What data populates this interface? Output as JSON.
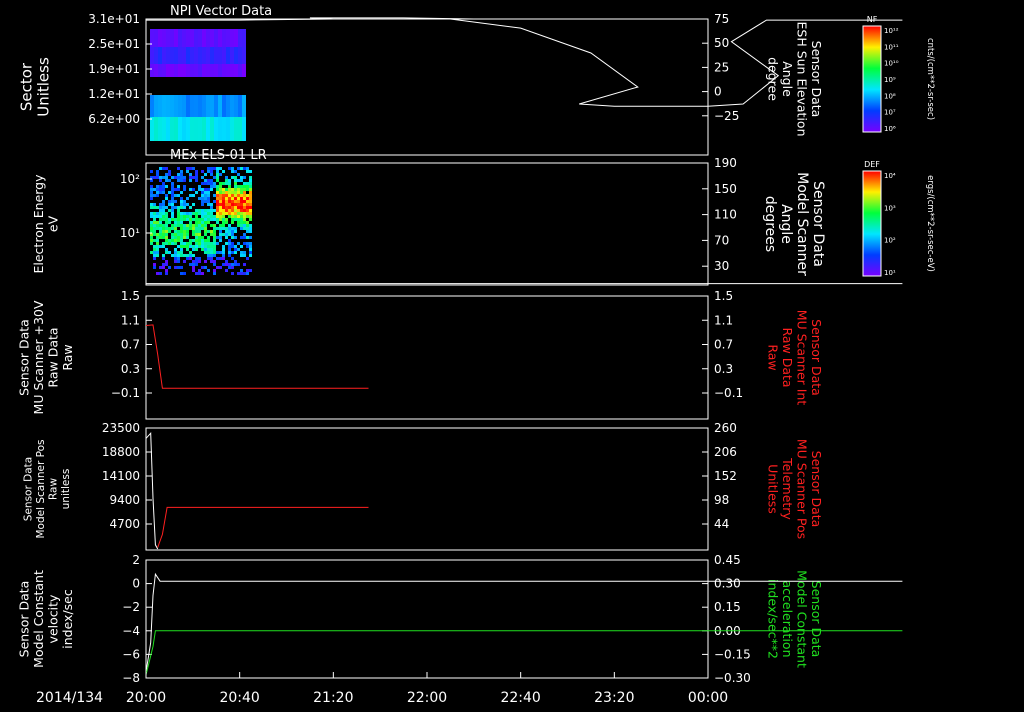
{
  "chart_data": [
    {
      "type": "heatmap",
      "title": "NPI Vector Data",
      "ylabel_left": [
        "Sector",
        "Unitless"
      ],
      "yticks_left": [
        "3.1e+01",
        "2.5e+01",
        "1.9e+01",
        "1.2e+01",
        "6.2e+00"
      ],
      "ylabel_right": [
        "Sensor Data",
        "ESH Sun Elevation",
        "Angle",
        "degree"
      ],
      "yticks_right": [
        "75",
        "50",
        "25",
        "0",
        "−25"
      ],
      "right_range": [
        -45,
        75
      ],
      "overlay_color": "#ffffff",
      "overlay_line": [
        [
          20.0,
          74
        ],
        [
          20.4,
          74
        ],
        [
          20.8,
          75
        ],
        [
          21.1,
          76
        ],
        [
          21.5,
          76
        ],
        [
          21.8,
          75
        ],
        [
          22.1,
          75
        ],
        [
          22.4,
          67
        ],
        [
          22.7,
          45
        ],
        [
          22.9,
          15
        ],
        [
          23.05,
          0
        ],
        [
          23.2,
          -2
        ],
        [
          23.6,
          -2
        ],
        [
          23.75,
          0
        ],
        [
          23.9,
          25
        ],
        [
          24.1,
          55
        ],
        [
          24.25,
          74
        ],
        [
          24.6,
          74
        ],
        [
          24.83,
          74
        ]
      ],
      "colorbar": {
        "label": "NF",
        "unit": "cnts/(cm**2-sr-sec)",
        "ticks": [
          "10¹²",
          "10¹¹",
          "10¹⁰",
          "10⁹",
          "10⁸",
          "10⁷",
          "10⁶"
        ]
      }
    },
    {
      "type": "heatmap",
      "title": "MEx ELS-01 LR",
      "ylabel_left": [
        "Electron Energy",
        "eV"
      ],
      "yticks_left": [
        "10²",
        "10¹"
      ],
      "ylabel_right": [
        "Sensor Data",
        "Model Scanner",
        "Angle",
        "degrees"
      ],
      "yticks_right": [
        "190",
        "150",
        "110",
        "70",
        "30"
      ],
      "right_range": [
        10,
        190
      ],
      "overlay_color": "#ffffff",
      "overlay_line": [
        [
          20.0,
          12
        ],
        [
          24.83,
          12
        ]
      ],
      "colorbar": {
        "label": "DEF",
        "unit": "ergs/(cm**2-sr-sec-eV)",
        "ticks": [
          "10⁴",
          "10³",
          "10²",
          "10¹"
        ]
      }
    },
    {
      "type": "line",
      "ylabel_left": [
        "Sensor Data",
        "MU Scanner +30V",
        "Raw Data",
        "Raw"
      ],
      "yticks_left": [
        "1.5",
        "1.1",
        "0.7",
        "0.3",
        "−0.1"
      ],
      "left_range": [
        -0.5,
        1.5
      ],
      "ylabel_right": [
        "Sensor Data",
        "MU Scanner Int",
        "Raw Data",
        "Raw"
      ],
      "yticks_right": [
        "1.5",
        "1.1",
        "0.7",
        "0.3",
        "−0.1"
      ],
      "series": [
        {
          "color": "#ff2020",
          "axis": "left",
          "points": [
            [
              20.0,
              1.02
            ],
            [
              20.03,
              1.03
            ],
            [
              20.05,
              0.55
            ],
            [
              20.07,
              0.0
            ],
            [
              20.1,
              0.0
            ],
            [
              20.95,
              0.0
            ]
          ]
        }
      ]
    },
    {
      "type": "line",
      "ylabel_left": [
        "Sensor Data",
        "Model Scanner Pos",
        "Raw",
        "unitless"
      ],
      "yticks_left": [
        "23500",
        "18800",
        "14100",
        "9400",
        "4700"
      ],
      "left_range": [
        0,
        23500
      ],
      "ylabel_right": [
        "Sensor Data",
        "MU Scanner Pos",
        "Telemetry",
        "Unitless"
      ],
      "yticks_right": [
        "260",
        "206",
        "152",
        "98",
        "44"
      ],
      "series": [
        {
          "color": "#ffffff",
          "axis": "left",
          "points": [
            [
              20.0,
              21500
            ],
            [
              20.02,
              22500
            ],
            [
              20.03,
              10000
            ],
            [
              20.04,
              1000
            ],
            [
              20.05,
              200
            ]
          ]
        },
        {
          "color": "#ff2020",
          "axis": "left",
          "points": [
            [
              20.05,
              500
            ],
            [
              20.07,
              3000
            ],
            [
              20.09,
              8200
            ],
            [
              20.95,
              8200
            ]
          ]
        }
      ]
    },
    {
      "type": "line",
      "ylabel_left": [
        "Sensor Data",
        "Model Constant",
        "velocity",
        "index/sec"
      ],
      "yticks_left": [
        "2",
        "0",
        "−2",
        "−4",
        "−6",
        "−8"
      ],
      "left_range": [
        -8,
        2
      ],
      "ylabel_right": [
        "Sensor Data",
        "Model Constant",
        "acceleration",
        "index/sec**2"
      ],
      "yticks_right": [
        "0.45",
        "0.30",
        "0.15",
        "0.00",
        "−0.15",
        "−0.30"
      ],
      "right_range": [
        -0.3,
        0.45
      ],
      "series": [
        {
          "color": "#ffffff",
          "axis": "left",
          "points": [
            [
              20.0,
              -7.5
            ],
            [
              20.02,
              -5
            ],
            [
              20.03,
              -1
            ],
            [
              20.04,
              0.8
            ],
            [
              20.06,
              0.2
            ],
            [
              24.83,
              0.2
            ]
          ]
        },
        {
          "color": "#20e020",
          "axis": "right",
          "points": [
            [
              20.0,
              -0.28
            ],
            [
              20.03,
              -0.1
            ],
            [
              20.04,
              0.0
            ],
            [
              24.83,
              0.0
            ]
          ]
        }
      ]
    }
  ],
  "time_axis": {
    "date_label": "2014/134",
    "ticks": [
      "20:00",
      "20:40",
      "21:20",
      "22:00",
      "22:40",
      "23:20",
      "00:00"
    ]
  },
  "colors": {
    "right_label_panel3": "#ff2020",
    "right_label_panel4": "#ff2020",
    "right_label_panel5": "#20e020"
  }
}
